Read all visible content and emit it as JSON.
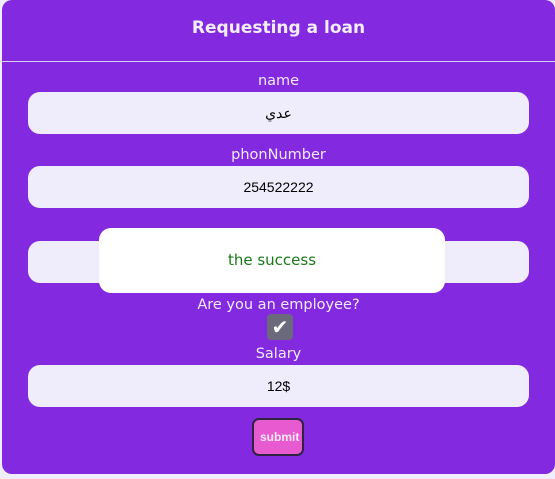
{
  "form": {
    "title": "Requesting a loan",
    "fields": [
      {
        "label": "name",
        "value": "عدي"
      },
      {
        "label": "phonNumber",
        "value": "254522222"
      },
      {
        "label": "",
        "value": ""
      }
    ],
    "employee_label": "Are you an employee?",
    "employee_checked": true,
    "salary_label": "Salary",
    "salary_value": "12$",
    "submit_label": "submit"
  },
  "popup": {
    "message": "the success",
    "color": "#177a17"
  },
  "colors": {
    "card": "#8329e0",
    "submit": "#e85ad0"
  }
}
